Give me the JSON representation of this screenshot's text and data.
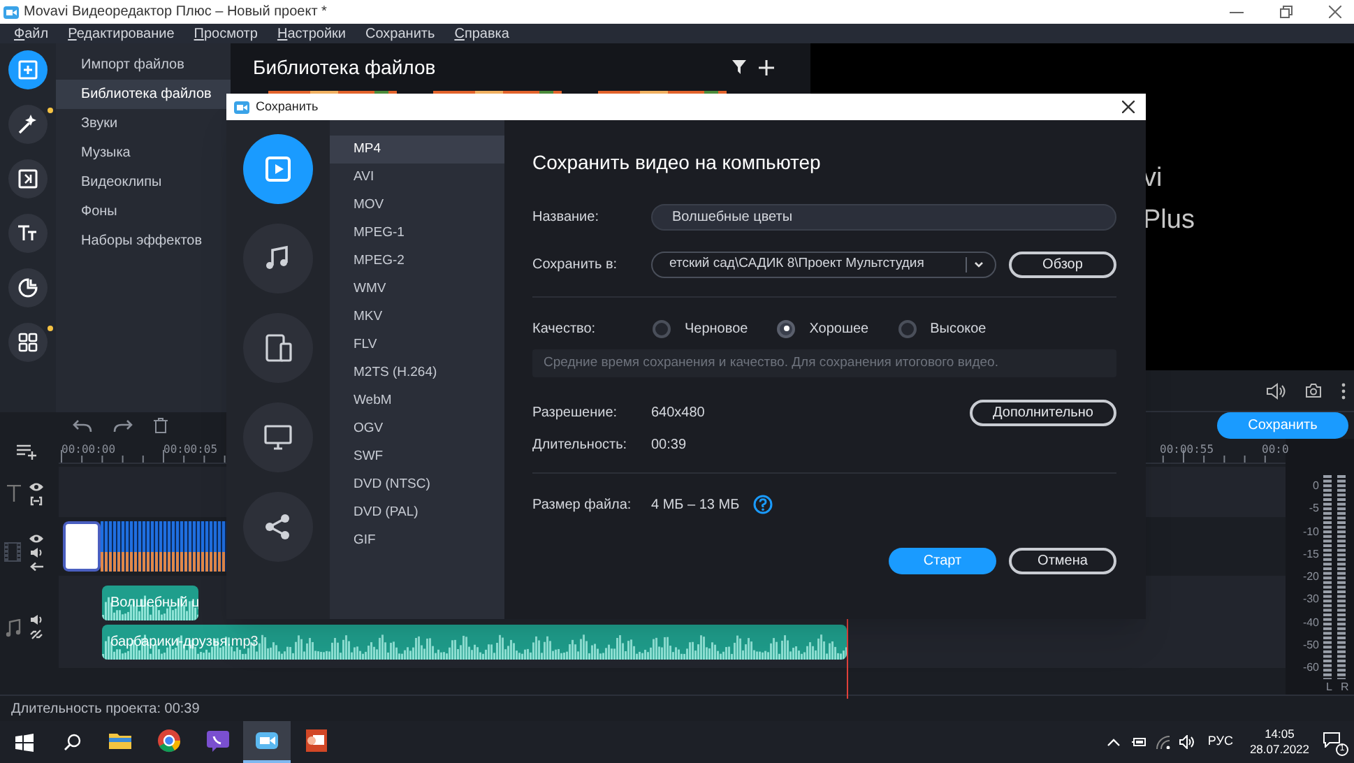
{
  "window": {
    "title": "Movavi Видеоредактор Плюс – Новый проект *"
  },
  "menu": [
    {
      "label": "Файл",
      "mnemonic": true
    },
    {
      "label": "Редактирование",
      "mnemonic": true
    },
    {
      "label": "Просмотр",
      "mnemonic": true
    },
    {
      "label": "Настройки",
      "mnemonic": true
    },
    {
      "label": "Сохранить",
      "mnemonic": false
    },
    {
      "label": "Справка",
      "mnemonic": true
    }
  ],
  "rail": [
    {
      "kind": "import",
      "selected": true,
      "badge": false
    },
    {
      "kind": "effects",
      "selected": false,
      "badge": true
    },
    {
      "kind": "transitions",
      "selected": false,
      "badge": false
    },
    {
      "kind": "titles",
      "selected": false,
      "badge": false
    },
    {
      "kind": "stickers",
      "selected": false,
      "badge": false
    },
    {
      "kind": "more",
      "selected": false,
      "badge": true
    }
  ],
  "categories": [
    {
      "label": "Импорт файлов",
      "selected": false
    },
    {
      "label": "Библиотека файлов",
      "selected": true
    },
    {
      "label": "Звуки",
      "selected": false
    },
    {
      "label": "Музыка",
      "selected": false
    },
    {
      "label": "Видеоклипы",
      "selected": false
    },
    {
      "label": "Фоны",
      "selected": false
    },
    {
      "label": "Наборы эффектов",
      "selected": false
    }
  ],
  "library": {
    "title": "Библиотека файлов"
  },
  "preview": {
    "logo_lines": [
      "vi",
      "Plus"
    ]
  },
  "export_button": "Сохранить",
  "timeline": {
    "ruler": [
      "00:00:00",
      "00:00:05",
      "00:00:55",
      "00:0"
    ],
    "audio_clips": [
      "Волшебный ц",
      "барбарики-друзья.mp3"
    ]
  },
  "meter": {
    "scale": [
      "0",
      "-5",
      "-10",
      "-15",
      "-20",
      "-30",
      "-40",
      "-50",
      "-60"
    ],
    "channels": [
      "L",
      "R"
    ]
  },
  "status_bar": "Длительность проекта: 00:39",
  "dialog": {
    "title": "Сохранить",
    "categories": [
      {
        "kind": "video",
        "selected": true
      },
      {
        "kind": "audio",
        "selected": false
      },
      {
        "kind": "devices",
        "selected": false
      },
      {
        "kind": "tv",
        "selected": false
      },
      {
        "kind": "share",
        "selected": false
      }
    ],
    "formats": [
      {
        "label": "MP4",
        "selected": true
      },
      {
        "label": "AVI",
        "selected": false
      },
      {
        "label": "MOV",
        "selected": false
      },
      {
        "label": "MPEG-1",
        "selected": false
      },
      {
        "label": "MPEG-2",
        "selected": false
      },
      {
        "label": "WMV",
        "selected": false
      },
      {
        "label": "MKV",
        "selected": false
      },
      {
        "label": "FLV",
        "selected": false
      },
      {
        "label": "M2TS (H.264)",
        "selected": false
      },
      {
        "label": "WebM",
        "selected": false
      },
      {
        "label": "OGV",
        "selected": false
      },
      {
        "label": "SWF",
        "selected": false
      },
      {
        "label": "DVD (NTSC)",
        "selected": false
      },
      {
        "label": "DVD (PAL)",
        "selected": false
      },
      {
        "label": "GIF",
        "selected": false
      }
    ],
    "heading": "Сохранить видео на компьютер",
    "name": {
      "label": "Название:",
      "value": "Волшебные цветы"
    },
    "folder": {
      "label": "Сохранить в:",
      "value": "етский сад\\САДИК 8\\Проект Мультстудия",
      "browse": "Обзор"
    },
    "quality": {
      "label": "Качество:",
      "options": [
        {
          "label": "Черновое",
          "selected": false
        },
        {
          "label": "Хорошее",
          "selected": true
        },
        {
          "label": "Высокое",
          "selected": false
        }
      ],
      "hint": "Средние время сохранения и качество. Для сохранения итогового видео."
    },
    "resolution": {
      "label": "Разрешение:",
      "value": "640x480"
    },
    "more": "Дополнительно",
    "duration": {
      "label": "Длительность:",
      "value": "00:39"
    },
    "size": {
      "label": "Размер файла:",
      "value": "4 МБ – 13 МБ"
    },
    "start": "Старт",
    "cancel": "Отмена"
  },
  "taskbar": {
    "apps": [
      {
        "kind": "folder",
        "selected": false
      },
      {
        "kind": "browser",
        "selected": false
      },
      {
        "kind": "messenger",
        "selected": false
      },
      {
        "kind": "editor",
        "selected": true
      },
      {
        "kind": "slides",
        "selected": false
      }
    ],
    "language": "РУС",
    "time": "14:05",
    "date": "28.07.2022",
    "notifications": "1"
  }
}
